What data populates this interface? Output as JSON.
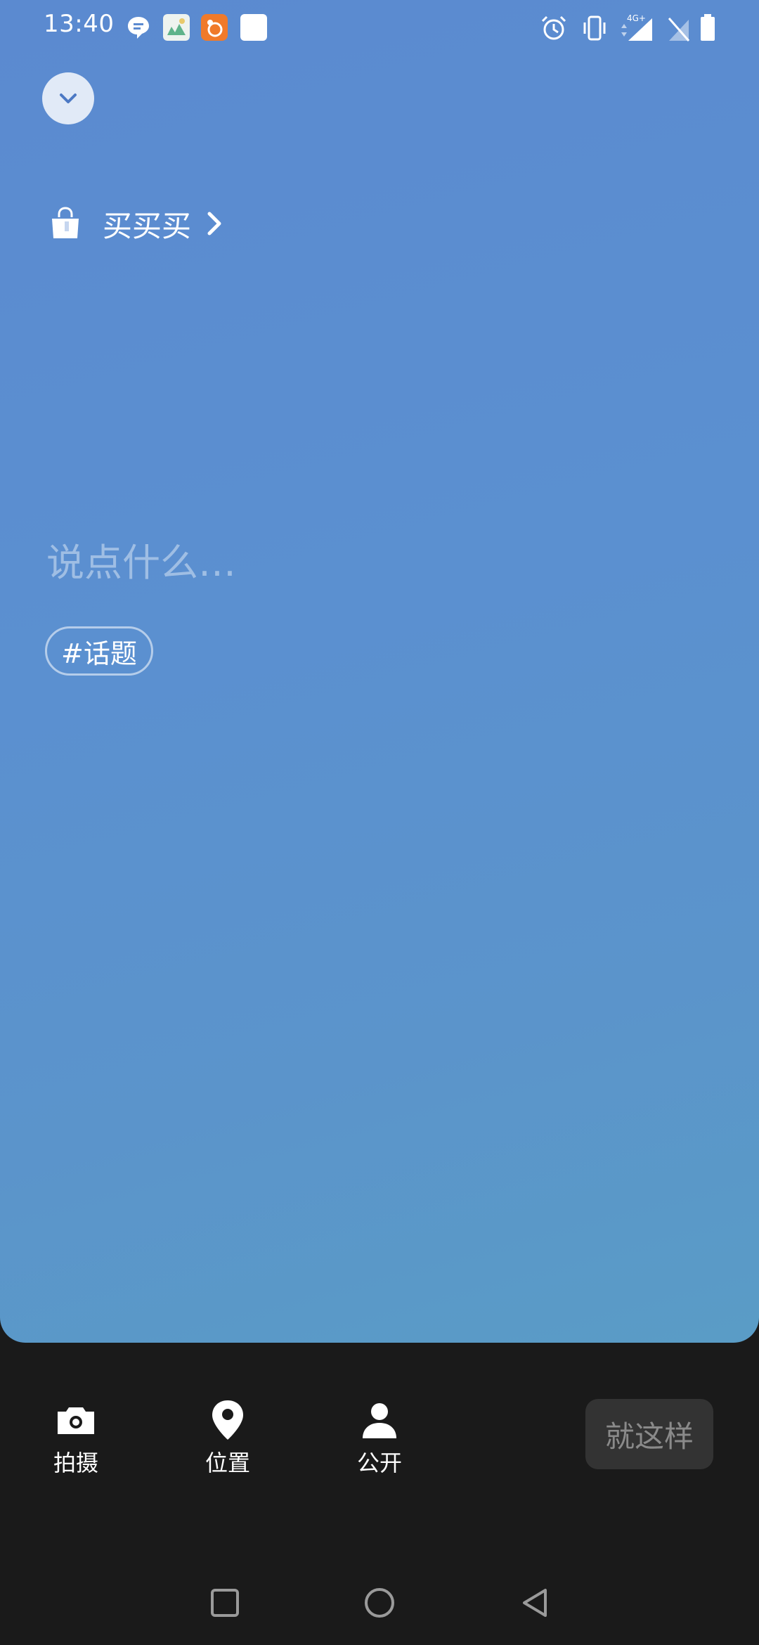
{
  "status_bar": {
    "time": "13:40",
    "network": "4G+"
  },
  "composer": {
    "collapse_icon": "chevron-down-icon",
    "shop_link_label": "买买买",
    "input_placeholder": "说点什么…",
    "topic_chip_label": "#话题"
  },
  "toolbar": {
    "items": [
      {
        "label": "拍摄",
        "icon": "camera-icon"
      },
      {
        "label": "位置",
        "icon": "location-pin-icon"
      },
      {
        "label": "公开",
        "icon": "person-icon"
      }
    ],
    "submit_label": "就这样"
  },
  "nav_bar": {
    "recents_icon": "square-icon",
    "home_icon": "circle-icon",
    "back_icon": "triangle-back-icon"
  },
  "colors": {
    "card_gradient_top": "#5b8ad0",
    "card_gradient_bottom": "#5a9cc6",
    "background": "#1a1a1a",
    "submit_bg": "#333333",
    "submit_text": "#8a8a8a"
  }
}
